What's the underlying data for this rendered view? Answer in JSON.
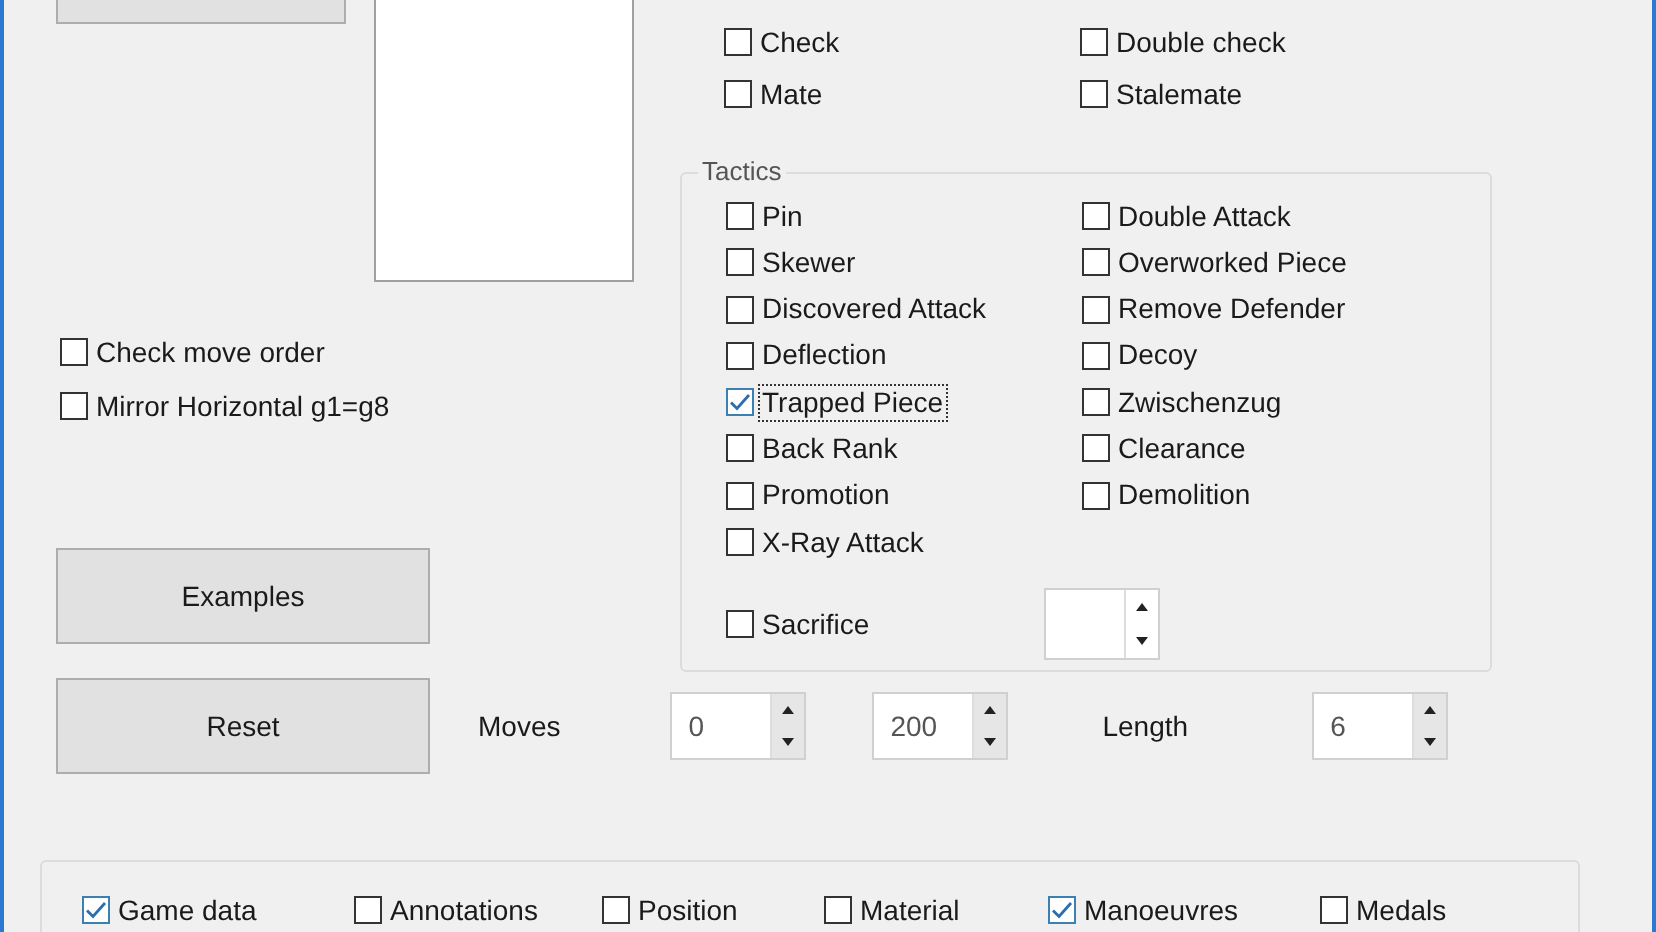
{
  "top_checks": [
    {
      "label": "Check",
      "checked": false
    },
    {
      "label": "Double check",
      "checked": false
    },
    {
      "label": "Mate",
      "checked": false
    },
    {
      "label": "Stalemate",
      "checked": false
    }
  ],
  "options": [
    {
      "label": "Check move order",
      "checked": false
    },
    {
      "label": "Mirror Horizontal g1=g8",
      "checked": false
    }
  ],
  "tactics": {
    "title": "Tactics",
    "items": [
      {
        "label": "Pin",
        "checked": false,
        "focused": false
      },
      {
        "label": "Double Attack",
        "checked": false,
        "focused": false
      },
      {
        "label": "Skewer",
        "checked": false,
        "focused": false
      },
      {
        "label": "Overworked Piece",
        "checked": false,
        "focused": false
      },
      {
        "label": "Discovered Attack",
        "checked": false,
        "focused": false
      },
      {
        "label": "Remove Defender",
        "checked": false,
        "focused": false
      },
      {
        "label": "Deflection",
        "checked": false,
        "focused": false
      },
      {
        "label": "Decoy",
        "checked": false,
        "focused": false
      },
      {
        "label": "Trapped Piece",
        "checked": true,
        "focused": true
      },
      {
        "label": "Zwischenzug",
        "checked": false,
        "focused": false
      },
      {
        "label": "Back Rank",
        "checked": false,
        "focused": false
      },
      {
        "label": "Clearance",
        "checked": false,
        "focused": false
      },
      {
        "label": "Promotion",
        "checked": false,
        "focused": false
      },
      {
        "label": "Demolition",
        "checked": false,
        "focused": false
      },
      {
        "label": "X-Ray Attack",
        "checked": false,
        "focused": false
      }
    ],
    "sacrifice": {
      "label": "Sacrifice",
      "checked": false
    }
  },
  "buttons": [
    "Examples",
    "Reset"
  ],
  "moves": {
    "label": "Moves",
    "from": "0",
    "to": "200"
  },
  "length": {
    "label": "Length",
    "value": "6"
  },
  "output_options": [
    {
      "label": "Game data",
      "checked": true
    },
    {
      "label": "Annotations",
      "checked": false
    },
    {
      "label": "Position",
      "checked": false
    },
    {
      "label": "Material",
      "checked": false
    },
    {
      "label": "Manoeuvres",
      "checked": true
    },
    {
      "label": "Medals",
      "checked": false
    }
  ]
}
